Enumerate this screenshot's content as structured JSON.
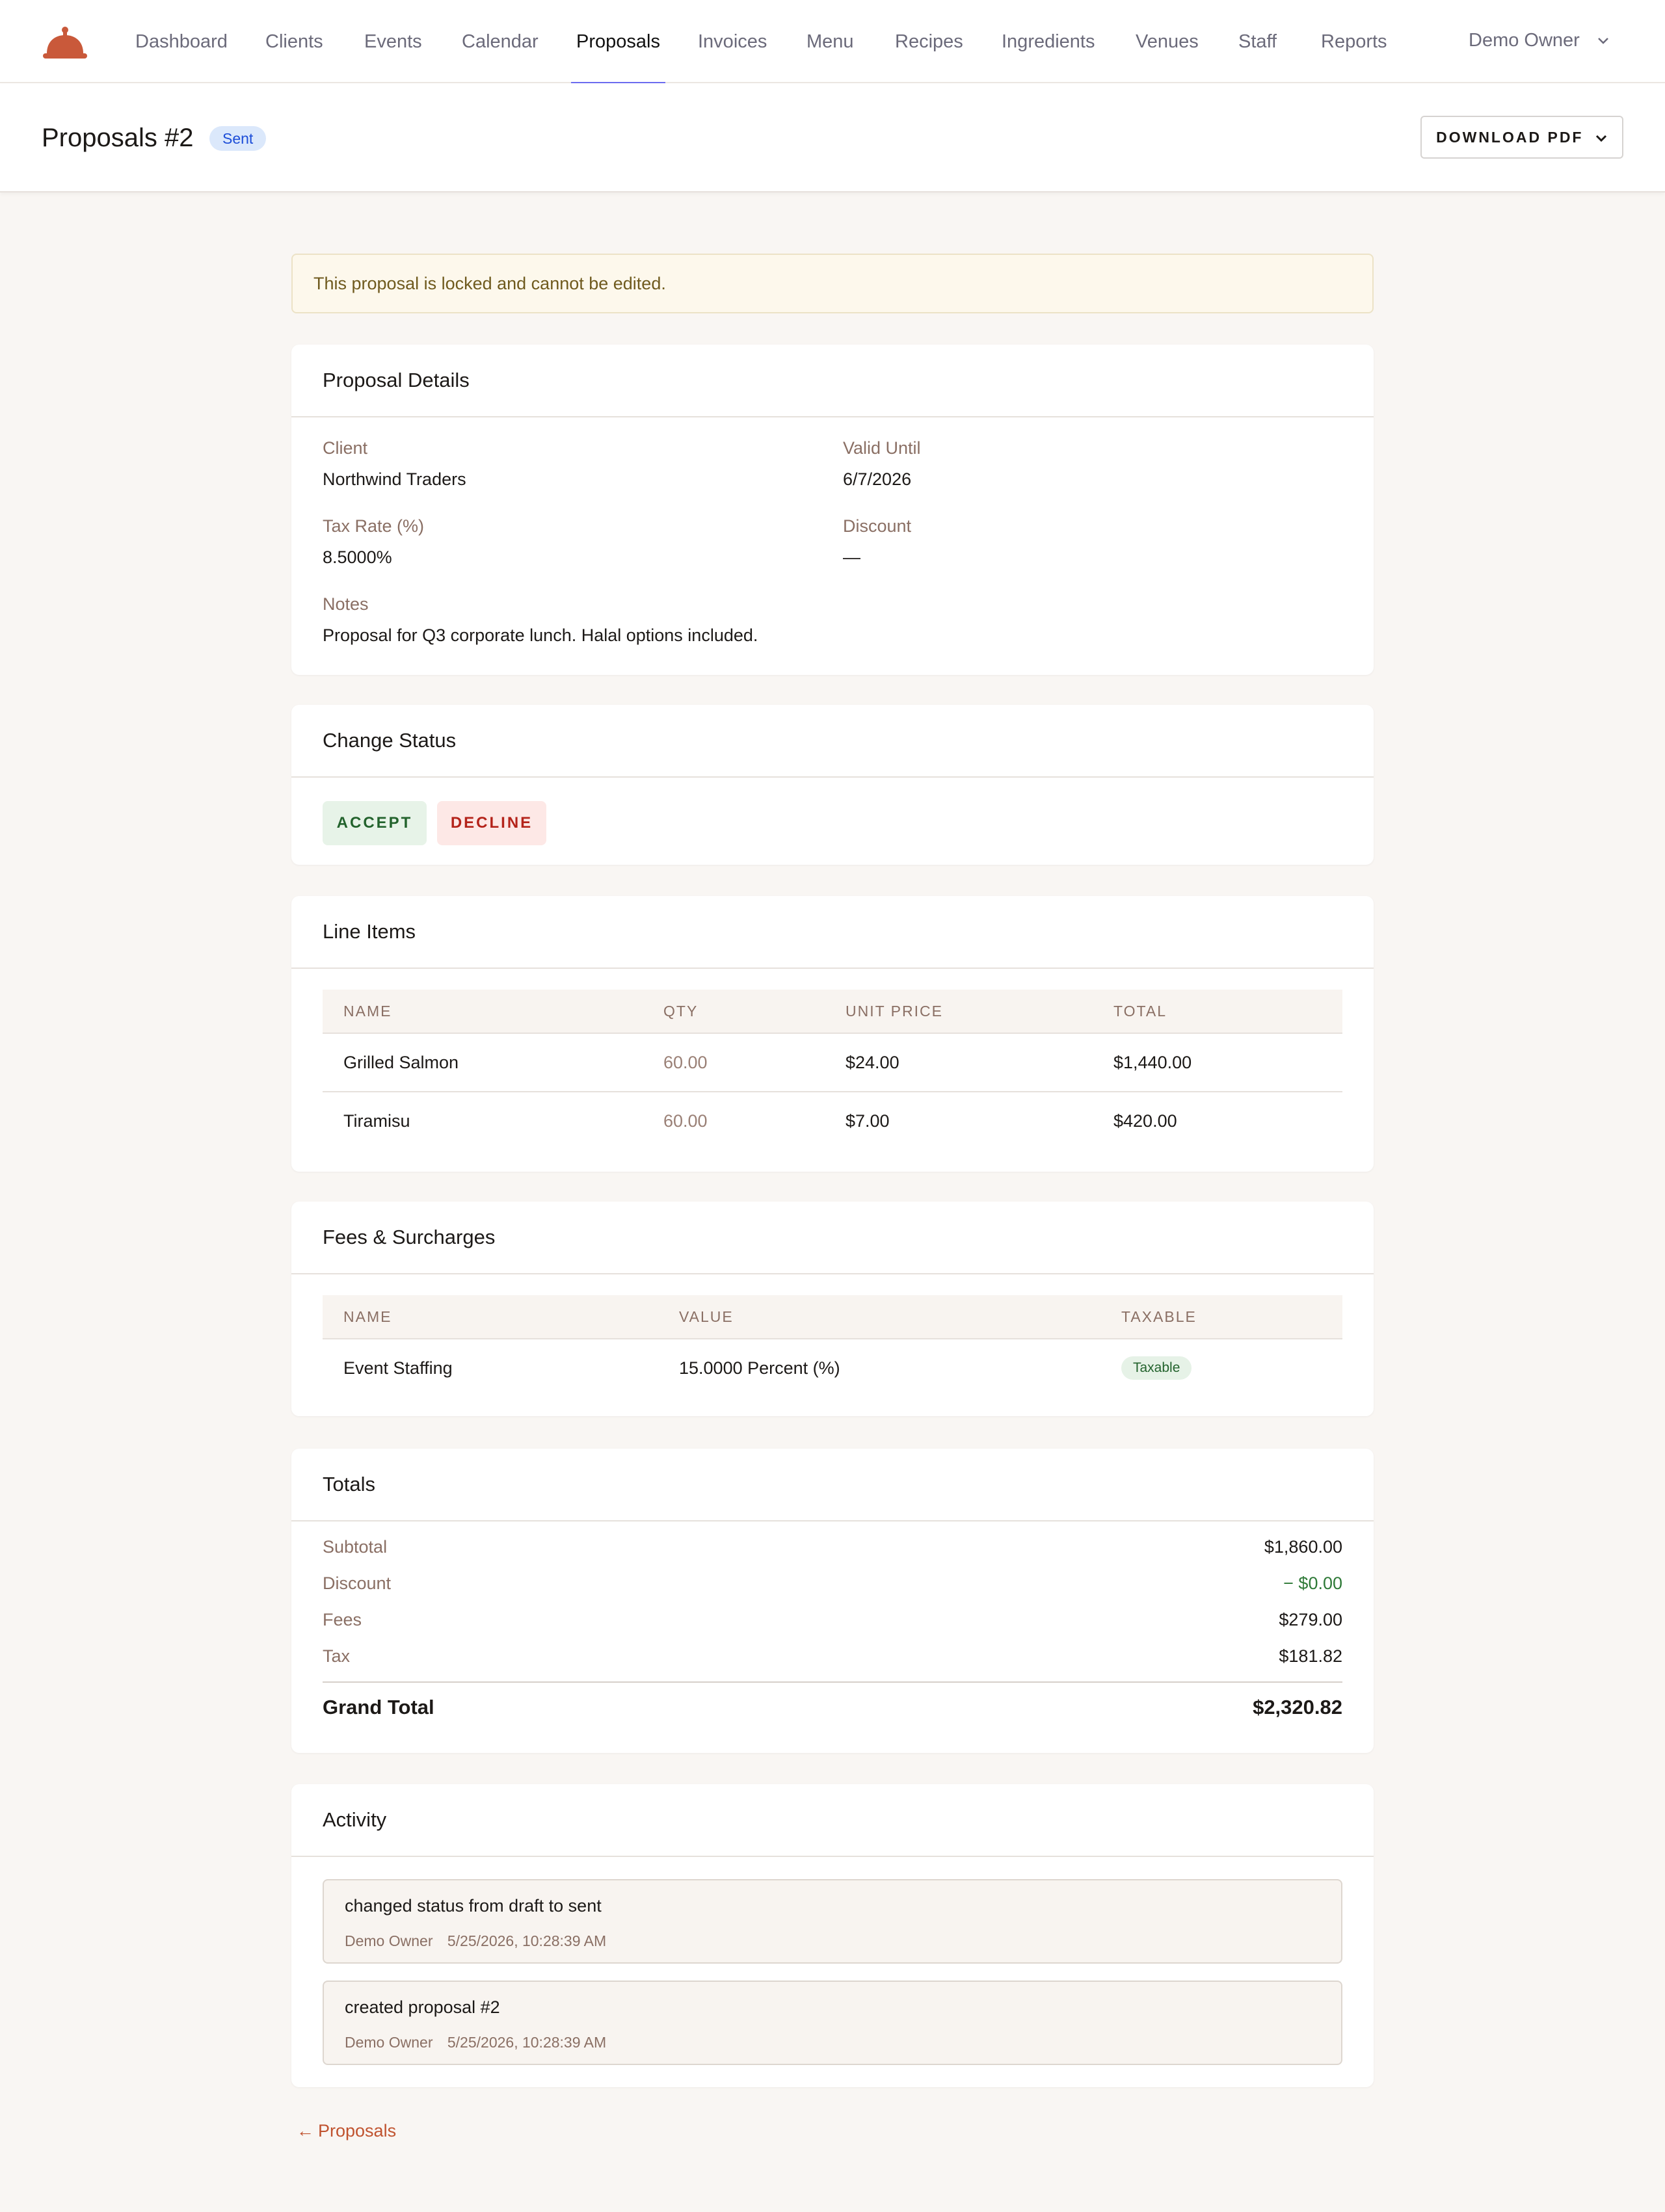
{
  "nav": {
    "items": [
      {
        "label": "Dashboard"
      },
      {
        "label": "Clients"
      },
      {
        "label": "Events"
      },
      {
        "label": "Calendar"
      },
      {
        "label": "Proposals",
        "active": true
      },
      {
        "label": "Invoices"
      },
      {
        "label": "Menu"
      },
      {
        "label": "Recipes"
      },
      {
        "label": "Ingredients"
      },
      {
        "label": "Venues"
      },
      {
        "label": "Staff"
      },
      {
        "label": "Reports"
      }
    ],
    "user": "Demo Owner",
    "accent_color": "#6c6cf0",
    "logo_icon": "cloche-icon"
  },
  "header": {
    "title": "Proposals #2",
    "status": "Sent",
    "download_label": "DOWNLOAD PDF"
  },
  "alert": "This proposal is locked and cannot be edited.",
  "details": {
    "title": "Proposal Details",
    "client_label": "Client",
    "client": "Northwind Traders",
    "valid_until_label": "Valid Until",
    "valid_until": "6/7/2026",
    "tax_rate_label": "Tax Rate (%)",
    "tax_rate": "8.5000%",
    "discount_label": "Discount",
    "discount": "—",
    "notes_label": "Notes",
    "notes": "Proposal for Q3 corporate lunch. Halal options included."
  },
  "status_change": {
    "title": "Change Status",
    "accept": "ACCEPT",
    "decline": "DECLINE"
  },
  "line_items": {
    "title": "Line Items",
    "headers": [
      "NAME",
      "QTY",
      "UNIT PRICE",
      "TOTAL"
    ],
    "rows": [
      {
        "name": "Grilled Salmon",
        "qty": "60.00",
        "unit_price": "$24.00",
        "total": "$1,440.00"
      },
      {
        "name": "Tiramisu",
        "qty": "60.00",
        "unit_price": "$7.00",
        "total": "$420.00"
      }
    ]
  },
  "fees": {
    "title": "Fees & Surcharges",
    "headers": [
      "NAME",
      "VALUE",
      "TAXABLE"
    ],
    "rows": [
      {
        "name": "Event Staffing",
        "value": "15.0000 Percent (%)",
        "taxable": "Taxable"
      }
    ]
  },
  "totals": {
    "title": "Totals",
    "subtotal_label": "Subtotal",
    "subtotal": "$1,860.00",
    "discount_label": "Discount",
    "discount": "− $0.00",
    "fees_label": "Fees",
    "fees": "$279.00",
    "tax_label": "Tax",
    "tax": "$181.82",
    "grand_label": "Grand Total",
    "grand": "$2,320.82"
  },
  "activity": {
    "title": "Activity",
    "items": [
      {
        "text": "changed status from draft to sent",
        "user": "Demo Owner",
        "time": "5/25/2026, 10:28:39 AM"
      },
      {
        "text": "created proposal #2",
        "user": "Demo Owner",
        "time": "5/25/2026, 10:28:39 AM"
      }
    ]
  },
  "back_link": "Proposals"
}
